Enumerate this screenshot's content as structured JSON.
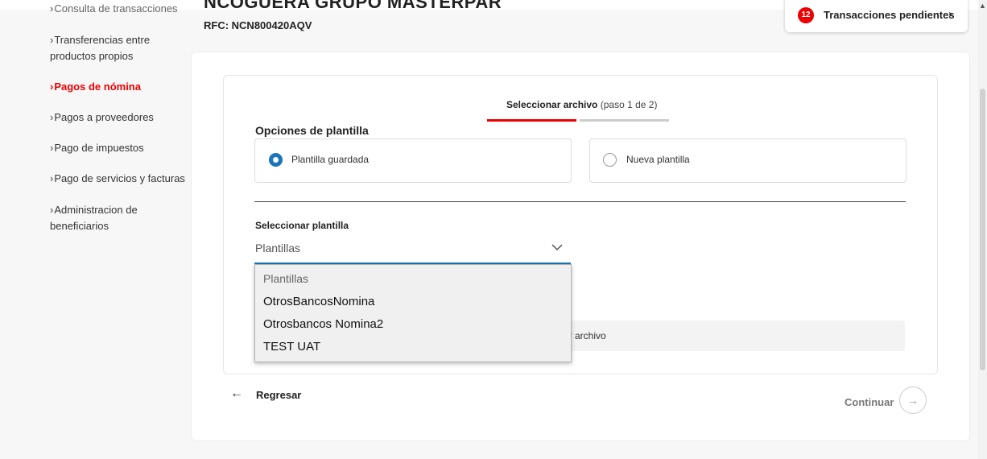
{
  "header": {
    "company_name": "NCOGUERA GRUPO MASTERPAR",
    "rfc": "RFC: NCN800420AQV",
    "pending": {
      "count": "12",
      "label": "Transacciones pendientes"
    }
  },
  "sidebar": {
    "items": [
      {
        "label": "Consulta de transacciones",
        "active": false
      },
      {
        "label": "Transferencias entre",
        "label2": "productos propios",
        "active": false
      },
      {
        "label": "Pagos de nómina",
        "active": true
      },
      {
        "label": "Pagos a proveedores",
        "active": false
      },
      {
        "label": "Pago de impuestos",
        "active": false
      },
      {
        "label": "Pago de servicios y facturas",
        "active": false
      },
      {
        "label": "Administracion de",
        "label2": "beneficiarios",
        "active": false
      }
    ]
  },
  "stepper": {
    "title": "Seleccionar archivo",
    "subtitle": "(paso 1 de 2)"
  },
  "template_options": {
    "title": "Opciones de plantilla",
    "saved": "Plantilla guardada",
    "new": "Nueva plantilla",
    "selected": "saved"
  },
  "template_select": {
    "label": "Seleccionar plantilla",
    "value": "Plantillas",
    "options": [
      "Plantillas",
      "OtrosBancosNomina",
      "Otrosbancos Nomina2",
      "TEST UAT"
    ]
  },
  "file": {
    "label": "Buscar archivo",
    "visible_label": "scar archivo"
  },
  "actions": {
    "back": "Regresar",
    "continue": "Continuar"
  },
  "colors": {
    "accent": "#ec0000",
    "focus": "#1b75bc"
  }
}
